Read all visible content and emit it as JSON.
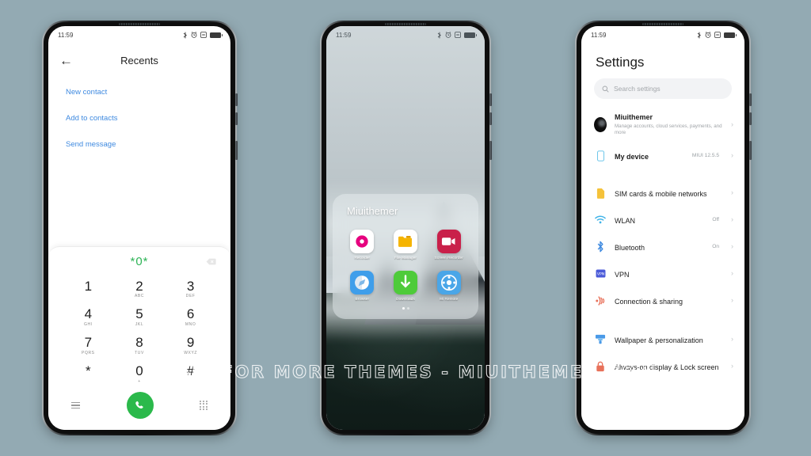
{
  "watermark": "VISIT FOR MORE THEMES - MIUITHEMER.COM",
  "background_color": "#93aab3",
  "phone1": {
    "status": {
      "time": "11:59"
    },
    "header": {
      "back_icon": "back-arrow-icon",
      "title": "Recents"
    },
    "links": [
      {
        "label": "New contact"
      },
      {
        "label": "Add to contacts"
      },
      {
        "label": "Send message"
      }
    ],
    "dialer": {
      "entry": "*0*",
      "backspace_icon": "backspace-icon",
      "accent": "#2fb457",
      "keys": [
        {
          "digit": "1",
          "letters": ""
        },
        {
          "digit": "2",
          "letters": "ABC"
        },
        {
          "digit": "3",
          "letters": "DEF"
        },
        {
          "digit": "4",
          "letters": "GHI"
        },
        {
          "digit": "5",
          "letters": "JKL"
        },
        {
          "digit": "6",
          "letters": "MNO"
        },
        {
          "digit": "7",
          "letters": "PQRS"
        },
        {
          "digit": "8",
          "letters": "TUV"
        },
        {
          "digit": "9",
          "letters": "WXYZ"
        },
        {
          "digit": "*",
          "letters": ""
        },
        {
          "digit": "0",
          "letters": "+"
        },
        {
          "digit": "#",
          "letters": ""
        }
      ],
      "bar": {
        "menu_icon": "hamburger-menu-icon",
        "call_icon": "call-icon",
        "keypad_icon": "keypad-icon",
        "call_button_color": "#2bb94b"
      }
    }
  },
  "phone2": {
    "status": {
      "time": "11:59"
    },
    "folder": {
      "title": "Miuithemer",
      "apps": [
        {
          "label": "Recorder",
          "icon": "recorder-icon",
          "bg": "#ffffff",
          "fg": "#e6007e"
        },
        {
          "label": "File Manager",
          "icon": "file-manager-icon",
          "bg": "#ffffff",
          "fg": "#f5b400"
        },
        {
          "label": "Screen Recorder",
          "icon": "screen-recorder-icon",
          "bg": "#c9204a",
          "fg": "#ffffff"
        },
        {
          "label": "Browser",
          "icon": "browser-icon",
          "bg": "#3f9eea",
          "fg": "#ffffff"
        },
        {
          "label": "Downloads",
          "icon": "downloads-icon",
          "bg": "#4ecb3a",
          "fg": "#ffffff"
        },
        {
          "label": "Mi Remote",
          "icon": "mi-remote-icon",
          "bg": "#4aa6e8",
          "fg": "#ffffff"
        }
      ],
      "page_indicator": {
        "total": 2,
        "active": 1
      }
    }
  },
  "phone3": {
    "status": {
      "time": "11:59"
    },
    "title": "Settings",
    "search": {
      "placeholder": "Search settings",
      "icon": "search-icon"
    },
    "account": {
      "name": "Miuithemer",
      "subtitle": "Manage accounts, cloud services, payments, and more",
      "avatar": "avatar"
    },
    "device": {
      "label": "My device",
      "value": "MIUI 12.5.5",
      "icon": "device-icon"
    },
    "items": [
      {
        "label": "SIM cards & mobile networks",
        "value": "",
        "icon": "sim-card-icon",
        "color": "#f5c23a"
      },
      {
        "label": "WLAN",
        "value": "Off",
        "icon": "wifi-icon",
        "color": "#3fb3e8"
      },
      {
        "label": "Bluetooth",
        "value": "On",
        "icon": "bluetooth-icon",
        "color": "#3f8ae0"
      },
      {
        "label": "VPN",
        "value": "",
        "icon": "vpn-icon",
        "color": "#4a5ad8"
      },
      {
        "label": "Connection & sharing",
        "value": "",
        "icon": "connection-icon",
        "color": "#e8715a"
      }
    ],
    "items2": [
      {
        "label": "Wallpaper & personalization",
        "value": "",
        "icon": "wallpaper-icon",
        "color": "#4a9ae8"
      },
      {
        "label": "Always-on display & Lock screen",
        "value": "",
        "icon": "lock-icon",
        "color": "#e8715a"
      }
    ]
  }
}
